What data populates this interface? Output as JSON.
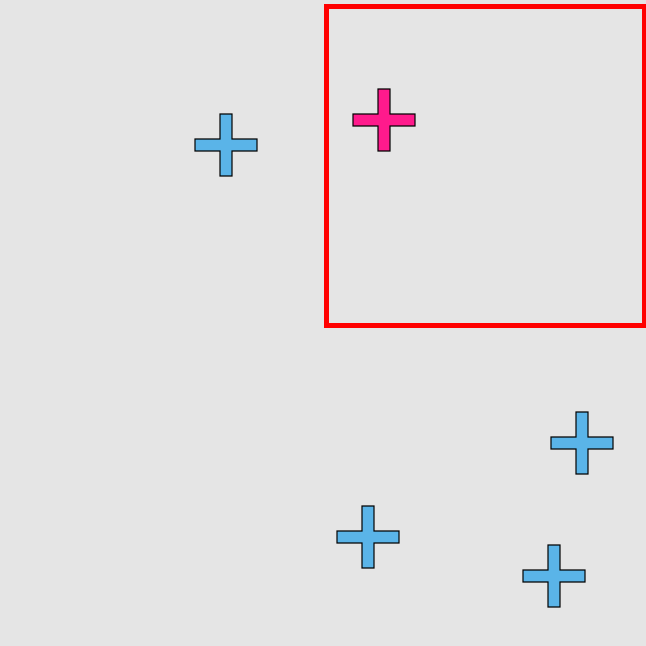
{
  "colors": {
    "background": "#e5e5e5",
    "highlight_box": "#ff0000",
    "target_cross": "#ff1a8c",
    "distractor_cross": "#5ab4e8",
    "outline": "#000000"
  },
  "shapes": {
    "target": {
      "icon": "plus-cross",
      "color": "#ff1a8c"
    },
    "distractors": [
      {
        "icon": "plus-cross",
        "color": "#5ab4e8"
      },
      {
        "icon": "plus-cross",
        "color": "#5ab4e8"
      },
      {
        "icon": "plus-cross",
        "color": "#5ab4e8"
      },
      {
        "icon": "plus-cross",
        "color": "#5ab4e8"
      }
    ]
  }
}
